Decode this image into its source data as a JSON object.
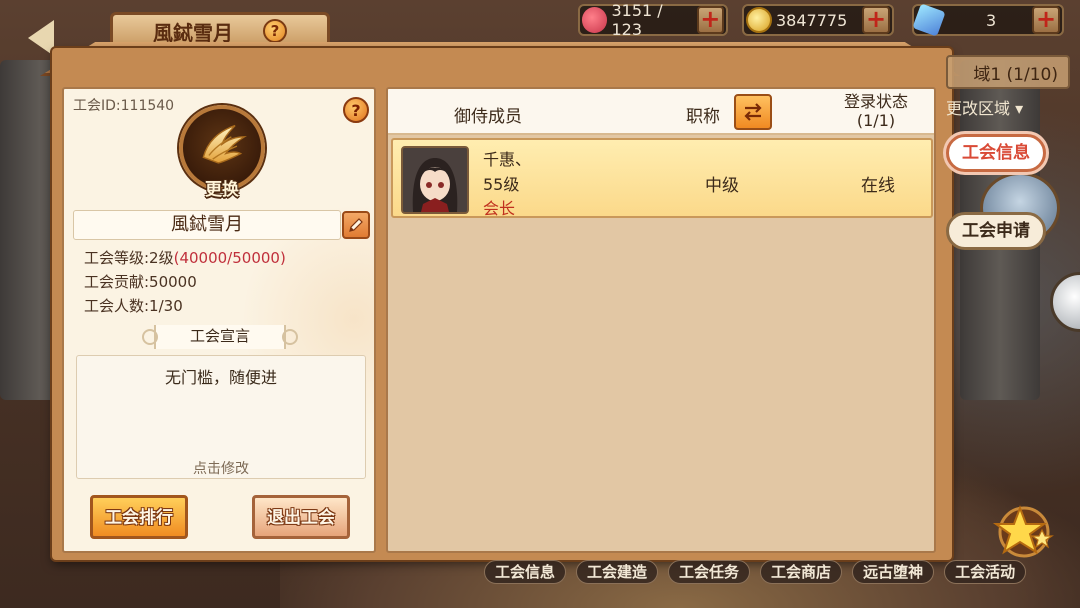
{
  "top_bar": {
    "guild_name_tab": "風鋱雪月",
    "help_glyph": "?",
    "stamina": "3151 / 123",
    "gold": "3847775",
    "gems": "3",
    "plus_glyph": "+"
  },
  "frame_right": {
    "server_tab": "域1 (1/10)",
    "change_region": "更改区域 ▾"
  },
  "guild_info": {
    "id_label": "工会ID:111540",
    "change_label": "更换",
    "name": "風鋱雪月",
    "level_prefix": "工会等级:2级",
    "level_exp": "(40000/50000)",
    "contribution": "工会贡献:50000",
    "members_count": "工会人数:1/30",
    "declaration_title": "工会宣言",
    "declaration_text": "无门槛，随便进",
    "declaration_hint": "点击修改",
    "rank_button": "工会排行",
    "quit_button": "退出工会"
  },
  "members_table": {
    "headers": {
      "member": "御侍成员",
      "title": "职称",
      "login_status": "登录状态",
      "login_count": "(1/1)"
    },
    "rows": [
      {
        "name": "千惠、",
        "level": "55级",
        "role": "会长",
        "rank": "中级",
        "status": "在线"
      }
    ]
  },
  "side_tabs": {
    "guild_info": "工会信息",
    "guild_apply": "工会申请"
  },
  "bottom_nav": {
    "items": [
      "工会信息",
      "工会建造",
      "工会任务",
      "工会商店",
      "远古堕神",
      "工会活动"
    ]
  },
  "colors": {
    "accent_orange": "#f08c22",
    "level_red": "#c0303c",
    "role_red": "#c0301e",
    "active_tab_text": "#d94a36"
  },
  "icons": {
    "emblem": "winged-emblem-icon",
    "edit": "pencil-icon",
    "swap": "swap-arrows-icon",
    "back": "back-arrow-icon",
    "stamina": "heart-icon",
    "gold": "coin-icon",
    "gems": "crystal-icon"
  }
}
